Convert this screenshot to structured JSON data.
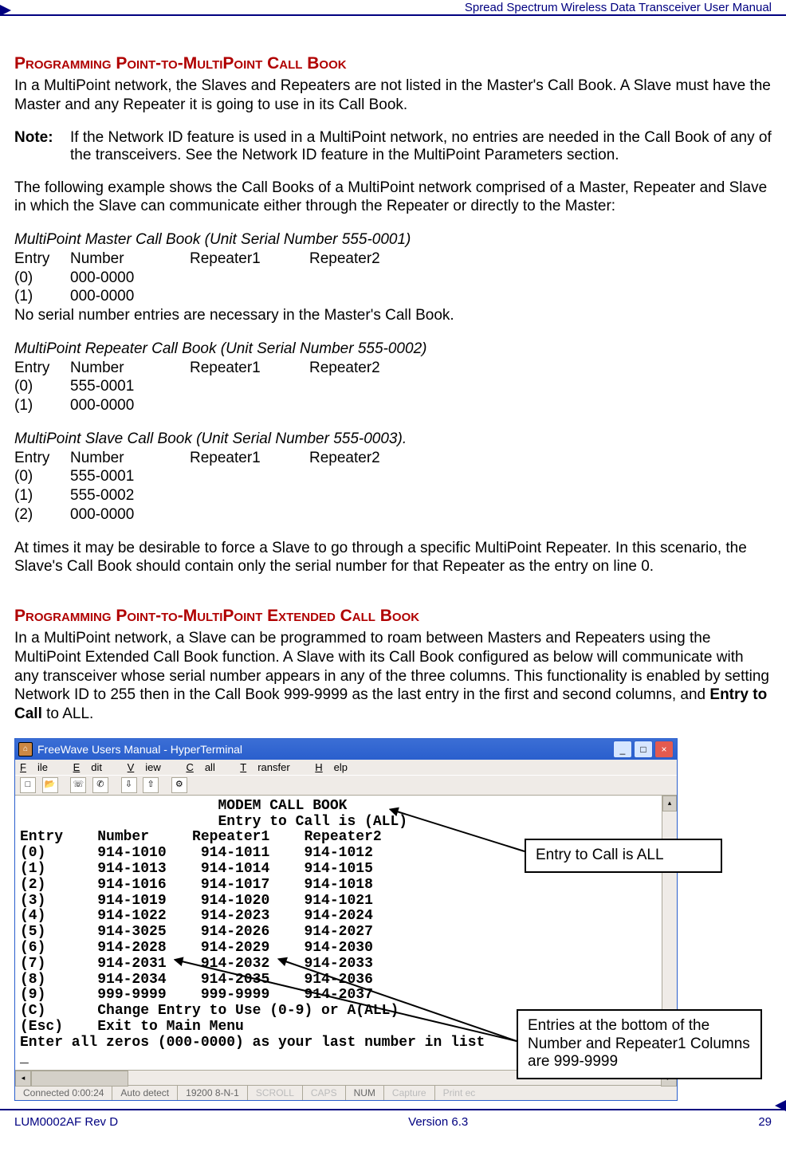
{
  "header": {
    "doc_title": "Spread Spectrum Wireless Data Transceiver User Manual"
  },
  "footer": {
    "left": "LUM0002AF Rev D",
    "center": "Version 6.3",
    "right": "29"
  },
  "section1": {
    "heading": "Programming Point-to-MultiPoint Call Book",
    "p1": "In a MultiPoint network, the Slaves and Repeaters are not listed in the Master's Call Book.  A Slave must have the Master and any Repeater it is going to use in its Call Book.",
    "note_label": "Note:",
    "note_body": "If the Network ID feature is used in a MultiPoint network, no entries are needed in the Call Book of any of the transceivers. See the Network ID feature in the MultiPoint Parameters section.",
    "p2": "The following example shows the Call Books of a MultiPoint network comprised of a Master, Repeater and Slave in which the Slave can communicate either through the Repeater or directly to the Master:"
  },
  "callbooks": {
    "headers": {
      "entry": "Entry",
      "number": "Number",
      "r1": "Repeater1",
      "r2": "Repeater2"
    },
    "master": {
      "title": "MultiPoint Master Call Book (Unit Serial Number 555-0001)",
      "rows": [
        {
          "entry": "(0)",
          "number": "000-0000",
          "r1": "",
          "r2": ""
        },
        {
          "entry": "(1)",
          "number": "000-0000",
          "r1": "",
          "r2": ""
        }
      ],
      "note": "No serial number entries are necessary in the Master's Call Book."
    },
    "repeater": {
      "title": "MultiPoint Repeater Call Book (Unit Serial Number 555-0002)",
      "rows": [
        {
          "entry": "(0)",
          "number": "555-0001",
          "r1": "",
          "r2": ""
        },
        {
          "entry": "(1)",
          "number": "000-0000",
          "r1": "",
          "r2": ""
        }
      ]
    },
    "slave": {
      "title": "MultiPoint Slave Call Book (Unit Serial Number 555-0003).",
      "rows": [
        {
          "entry": "(0)",
          "number": "555-0001",
          "r1": "",
          "r2": ""
        },
        {
          "entry": "(1)",
          "number": "555-0002",
          "r1": "",
          "r2": ""
        },
        {
          "entry": "(2)",
          "number": "000-0000",
          "r1": "",
          "r2": ""
        }
      ]
    }
  },
  "p_after_tables": "At times it may be desirable to force a Slave to go through a specific MultiPoint Repeater. In this scenario, the Slave's Call Book should contain only the serial number for that Repeater as the entry on line 0.",
  "section2": {
    "heading": "Programming Point-to-MultiPoint Extended Call Book",
    "p1_pre": "In a MultiPoint network, a Slave can be programmed to roam between Masters and Repeaters using the MultiPoint Extended Call Book function.  A Slave with its Call Book configured as below will communicate with any transceiver whose serial number appears in any of the three columns.  This functionality is enabled by setting Network ID to 255 then in the Call Book 999-9999 as the last entry in the first and second columns, and ",
    "p1_bold": "Entry to Call",
    "p1_post": " to ALL."
  },
  "hyperterminal": {
    "title": "FreeWave Users Manual - HyperTerminal",
    "menus": [
      "File",
      "Edit",
      "View",
      "Call",
      "Transfer",
      "Help"
    ],
    "terminal_text": "                       MODEM CALL BOOK\n                       Entry to Call is (ALL)\nEntry    Number     Repeater1    Repeater2\n(0)      914-1010    914-1011    914-1012\n(1)      914-1013    914-1014    914-1015\n(2)      914-1016    914-1017    914-1018\n(3)      914-1019    914-1020    914-1021\n(4)      914-1022    914-2023    914-2024\n(5)      914-3025    914-2026    914-2027\n(6)      914-2028    914-2029    914-2030\n(7)      914-2031    914-2032    914-2033\n(8)      914-2034    914-2035    914-2036\n(9)      999-9999    999-9999    914-2037\n(C)      Change Entry to Use (0-9) or A(ALL)\n(Esc)    Exit to Main Menu\nEnter all zeros (000-0000) as your last number in list\n_",
    "status": {
      "connected": "Connected 0:00:24",
      "detect": "Auto detect",
      "baud": "19200 8-N-1",
      "scroll": "SCROLL",
      "caps": "CAPS",
      "num": "NUM",
      "capture": "Capture",
      "print": "Print ec"
    }
  },
  "callouts": {
    "c1": "Entry to Call is ALL",
    "c2": "Entries at the bottom of the Number and Repeater1 Columns are 999-9999"
  }
}
